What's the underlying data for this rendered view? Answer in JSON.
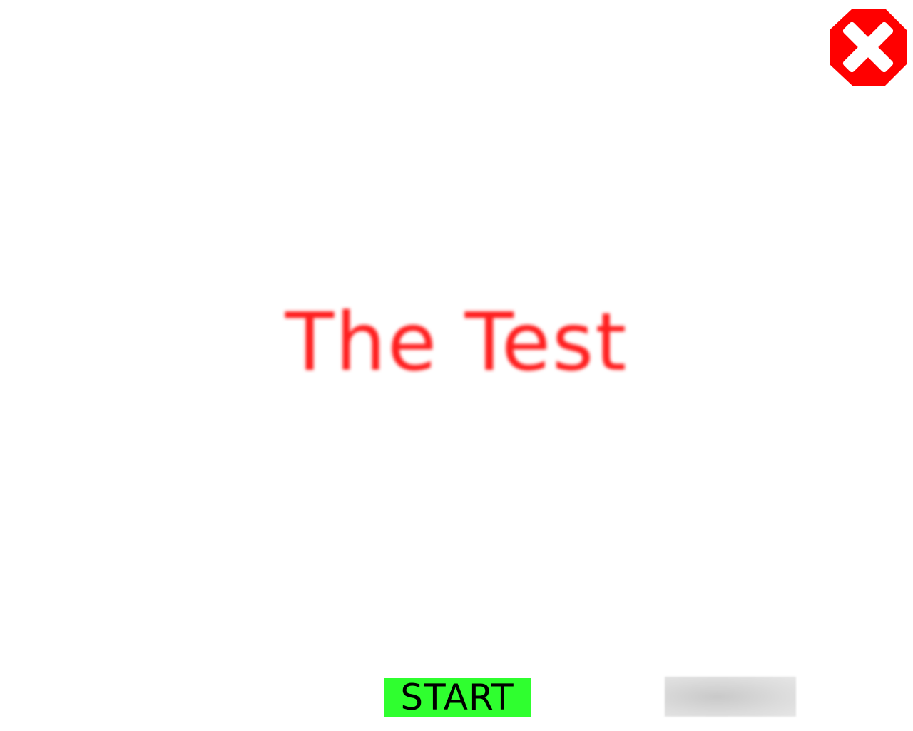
{
  "close_button": {
    "icon": "close-icon",
    "color": "#ff0000"
  },
  "title": {
    "text": "The Test",
    "color": "#ff1f1f"
  },
  "start_button": {
    "label": "START",
    "color": "#2fff2f"
  },
  "secondary_button": {
    "label": "",
    "color": "#d3d3d3"
  }
}
